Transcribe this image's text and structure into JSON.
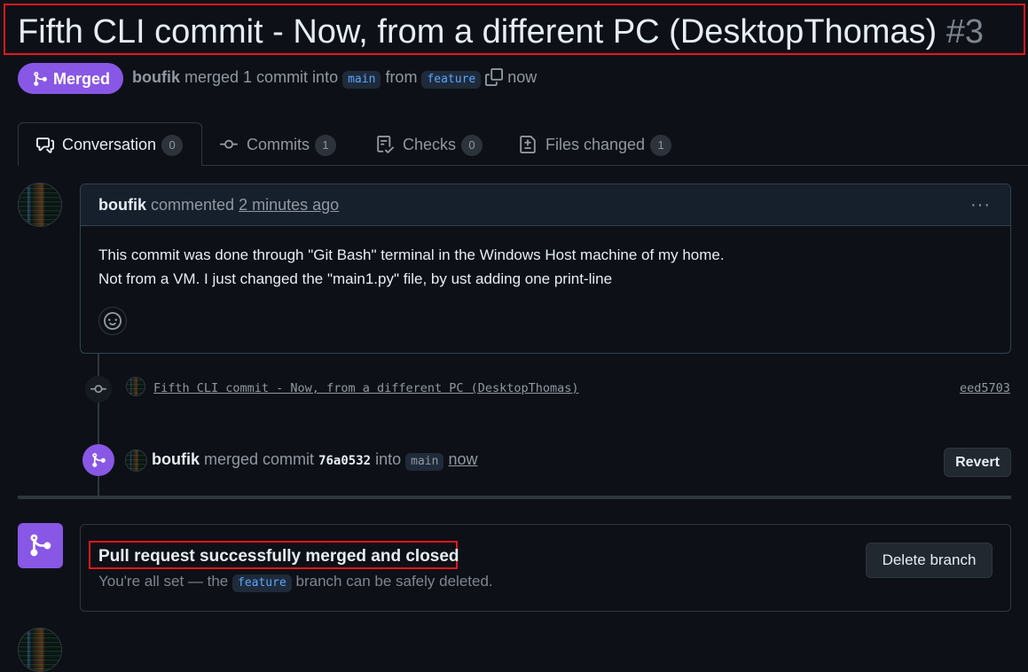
{
  "pr": {
    "title": "Fifth CLI commit - Now, from a different PC (DesktopThomas)",
    "number": "#3",
    "state_label": "Merged",
    "author": "boufik",
    "merge_text": "merged 1 commit into",
    "base_branch": "main",
    "from_text": "from",
    "head_branch": "feature",
    "time": "now"
  },
  "tabs": [
    {
      "label": "Conversation",
      "count": "0",
      "icon": "comment-discussion-icon"
    },
    {
      "label": "Commits",
      "count": "1",
      "icon": "git-commit-icon"
    },
    {
      "label": "Checks",
      "count": "0",
      "icon": "checklist-icon"
    },
    {
      "label": "Files changed",
      "count": "1",
      "icon": "file-diff-icon"
    }
  ],
  "comment": {
    "author": "boufik",
    "action": "commented",
    "time": "2 minutes ago",
    "line1": "This commit was done through \"Git Bash\" terminal in the Windows Host machine of my home.",
    "line2": "Not from a VM. I just changed the \"main1.py\" file, by ust adding one print-line",
    "more": "···"
  },
  "commit_event": {
    "message": "Fifth CLI commit - Now, from a different PC (DesktopThomas)",
    "sha": "eed5703"
  },
  "merge_event": {
    "author": "boufik",
    "action": "merged commit",
    "sha": "76a0532",
    "into": "into",
    "branch": "main",
    "time": "now",
    "revert_label": "Revert"
  },
  "merge_box": {
    "title": "Pull request successfully merged and closed",
    "sub_before": "You're all set — the",
    "branch": "feature",
    "sub_after": "branch can be safely deleted.",
    "delete_label": "Delete branch"
  },
  "colors": {
    "merged_purple": "#8957e5",
    "background": "#0d1117",
    "highlight_red": "#e5161d",
    "link_blue": "#58a6ff"
  }
}
